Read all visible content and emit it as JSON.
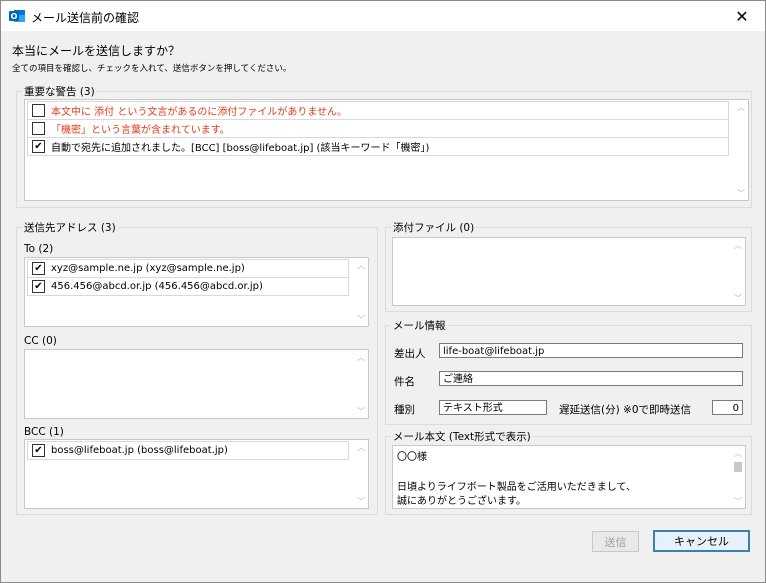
{
  "window": {
    "title": "メール送信前の確認",
    "app_icon": "outlook-icon"
  },
  "heading": "本当にメールを送信しますか？",
  "subheading": "全ての項目を確認し、チェックを入れて、送信ボタンを押してください。",
  "warnings": {
    "legend": "重要な警告 (3)",
    "items": [
      {
        "text": "本文中に 添付 という文言があるのに添付ファイルがありません。",
        "checked": false,
        "color": "#e53b1a"
      },
      {
        "text": "「機密」という言葉が含まれています。",
        "checked": false,
        "color": "#e53b1a"
      },
      {
        "text": "自動で宛先に追加されました。[BCC] [boss@lifeboat.jp] (該当キーワード「機密」)",
        "checked": true,
        "color": "#000000"
      }
    ]
  },
  "recipients": {
    "legend": "送信先アドレス (3)",
    "to_label": "To (2)",
    "to": [
      {
        "text": "xyz@sample.ne.jp (xyz@sample.ne.jp)",
        "checked": true
      },
      {
        "text": "456.456@abcd.or.jp (456.456@abcd.or.jp)",
        "checked": true
      }
    ],
    "cc_label": "CC (0)",
    "bcc_label": "BCC (1)",
    "bcc": [
      {
        "text": "boss@lifeboat.jp (boss@lifeboat.jp)",
        "checked": true
      }
    ]
  },
  "attachments": {
    "legend": "添付ファイル (0)"
  },
  "mail_info": {
    "legend": "メール情報",
    "sender_label": "差出人",
    "sender_value": "life-boat@lifeboat.jp",
    "subject_label": "件名",
    "subject_value": "ご連絡",
    "type_label": "種別",
    "type_value": "テキスト形式",
    "delay_label": "遅延送信(分) ※0で即時送信",
    "delay_value": "0"
  },
  "body": {
    "legend": "メール本文 (Text形式で表示)",
    "lines": [
      "〇〇様",
      "",
      "日頃よりライフボート製品をご活用いただきまして、",
      "誠にありがとうございます。"
    ]
  },
  "buttons": {
    "send": "送信",
    "cancel": "キャンセル"
  },
  "check_mark": "✔"
}
